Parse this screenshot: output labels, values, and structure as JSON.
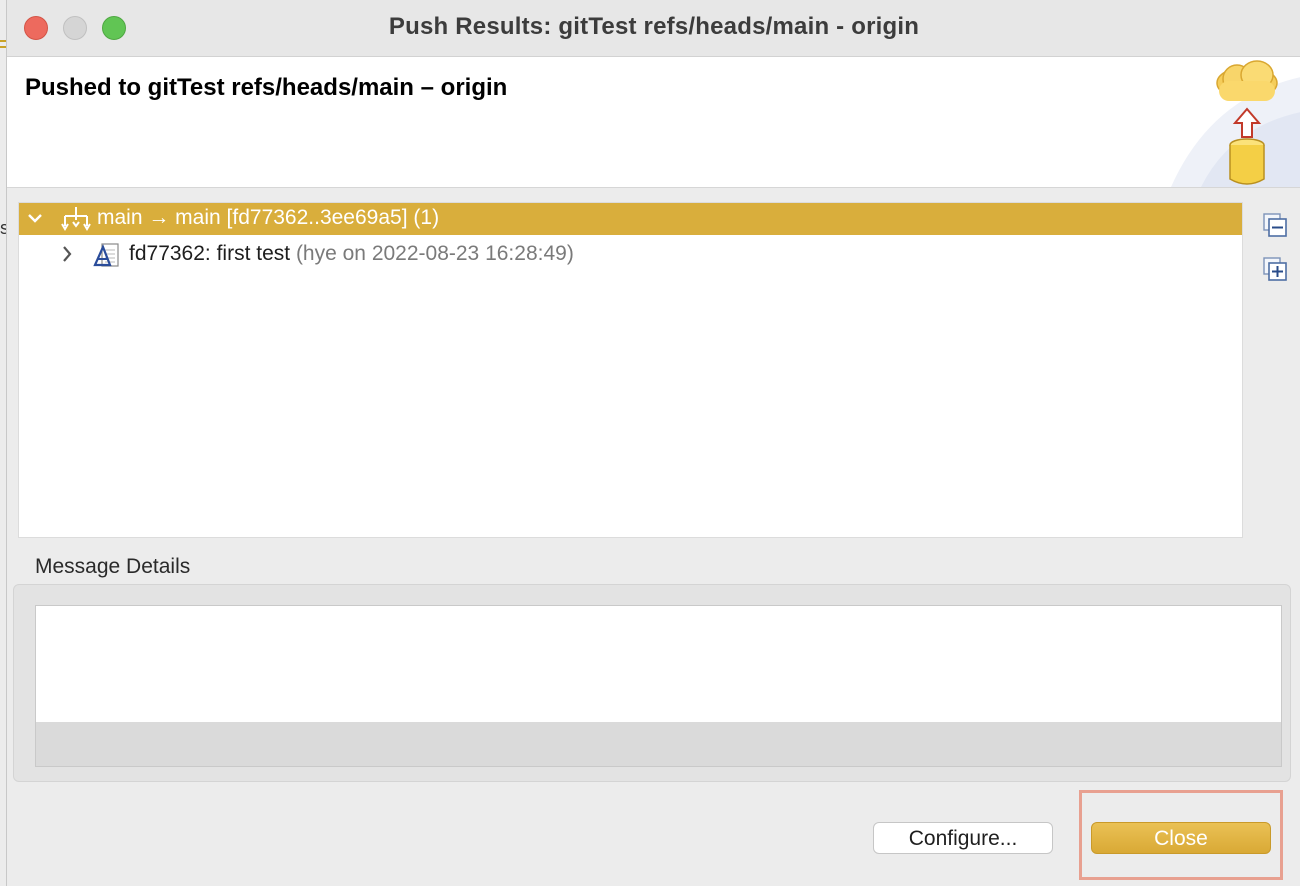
{
  "window": {
    "title": "Push Results: gitTest refs/heads/main - origin"
  },
  "banner": {
    "title": "Pushed to gitTest refs/heads/main – origin"
  },
  "tree": {
    "ref_row": {
      "label": "main → main [fd77362..3ee69a5]",
      "count": "(1)"
    },
    "commit_row": {
      "label": "fd77362: first test",
      "meta": "(hye on 2022-08-23 16:28:49)"
    }
  },
  "icons": {
    "collapse_all": "collapse-all-icon",
    "expand_all": "expand-all-icon",
    "ref": "push-ref-icon",
    "commit": "commit-icon"
  },
  "message_details": {
    "label": "Message Details",
    "content": ""
  },
  "buttons": {
    "configure": "Configure...",
    "close": "Close"
  },
  "background_fragment": {
    "glyph": "s"
  },
  "colors": {
    "selection": "#d9ae3c",
    "primary_button": "#e0b345",
    "highlight_box": "#e8a090"
  }
}
